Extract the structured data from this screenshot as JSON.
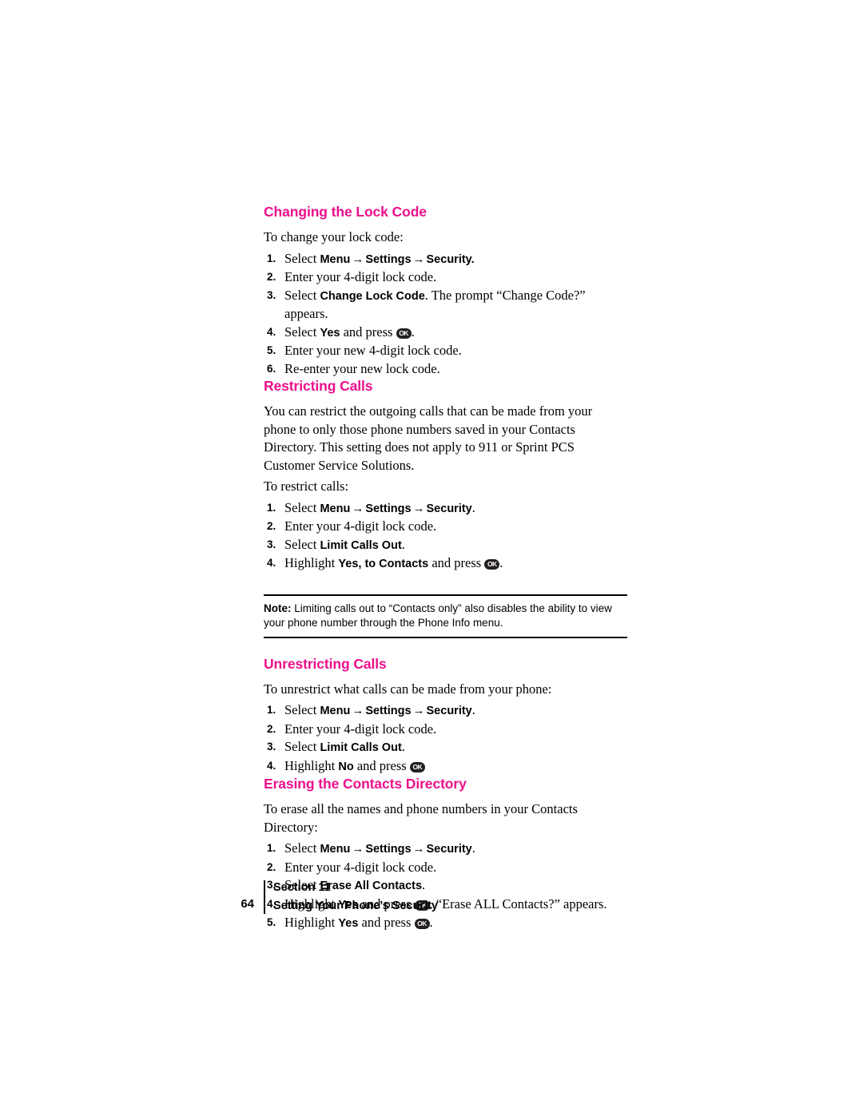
{
  "page": {
    "number": "64",
    "footer_line1": "Section  11",
    "footer_line2": "Setting Your Phone’s Security"
  },
  "sections": [
    {
      "heading": "Changing the Lock Code",
      "intro": "To change your lock code:",
      "steps": [
        {
          "n": "1.",
          "pre": "Select ",
          "b1": "Menu",
          "arrow1": "→",
          "b2": "Settings",
          "arrow2": "→",
          "b3": "Security",
          "post": "."
        },
        {
          "n": "2.",
          "text": "Enter your 4-digit lock code."
        },
        {
          "n": "3.",
          "pre": "Select ",
          "b1": "Change Lock Code",
          "post": ". The prompt “Change Code?” appears."
        },
        {
          "n": "4.",
          "pre": "Select ",
          "b1": "Yes",
          "mid": " and press ",
          "key": "OK",
          "post": "."
        },
        {
          "n": "5.",
          "text": "Enter your new 4-digit lock code."
        },
        {
          "n": "6.",
          "text": "Re-enter your new lock code."
        }
      ]
    },
    {
      "heading": "Restricting Calls",
      "para": "You can restrict the outgoing calls that can be made from your phone to only those phone numbers saved in your Contacts Directory. This setting does not apply to 911 or Sprint PCS Customer Service Solutions.",
      "intro": "To restrict calls:",
      "steps": [
        {
          "n": "1.",
          "pre": "Select ",
          "b1": "Menu",
          "arrow1": "→",
          "b2": "Settings",
          "arrow2": "→",
          "b3": "Security",
          "post": "."
        },
        {
          "n": "2.",
          "text": "Enter your 4-digit lock code."
        },
        {
          "n": "3.",
          "pre": "Select ",
          "b1": "Limit Calls Out",
          "post": "."
        },
        {
          "n": "4.",
          "pre": "Highlight ",
          "b1": "Yes, to Contacts",
          "mid": " and press ",
          "key": "OK",
          "post": "."
        }
      ]
    },
    {
      "heading": "Unrestricting Calls",
      "intro": "To unrestrict what calls can be made from your phone:",
      "steps": [
        {
          "n": "1.",
          "pre": "Select ",
          "b1": "Menu",
          "arrow1": "→",
          "b2": "Settings",
          "arrow2": "→",
          "b3": "Security",
          "post": "."
        },
        {
          "n": "2.",
          "text": "Enter your 4-digit lock code."
        },
        {
          "n": "3.",
          "pre": "Select ",
          "b1": "Limit Calls Out",
          "post": "."
        },
        {
          "n": "4.",
          "pre": "Highlight ",
          "b1": "No",
          "mid": " and press ",
          "key": "OK",
          "post": ""
        }
      ]
    },
    {
      "heading": "Erasing the Contacts Directory",
      "intro": "To erase all the names and phone numbers in your Contacts Directory:",
      "steps": [
        {
          "n": "1.",
          "pre": "Select ",
          "b1": "Menu",
          "arrow1": "→",
          "b2": "Settings",
          "arrow2": "→",
          "b3": "Security",
          "post": "."
        },
        {
          "n": "2.",
          "text": "Enter your 4-digit lock code."
        },
        {
          "n": "3.",
          "pre": "Select ",
          "b1": "Erase All Contacts",
          "post": "."
        },
        {
          "n": "4.",
          "pre": "Highlight ",
          "b1": "Yes",
          "mid": " and press ",
          "key": "OK",
          "post": ". “Erase ALL Contacts?” appears."
        },
        {
          "n": "5.",
          "pre": "Highlight ",
          "b1": "Yes",
          "mid": " and press ",
          "key": "OK",
          "post": "."
        }
      ]
    }
  ],
  "note": {
    "label": "Note:",
    "text": " Limiting calls out to “Contacts only” also disables the ability to view your phone number through the Phone Info menu."
  },
  "colors": {
    "heading": "#ED0F8C",
    "text": "#000000"
  }
}
